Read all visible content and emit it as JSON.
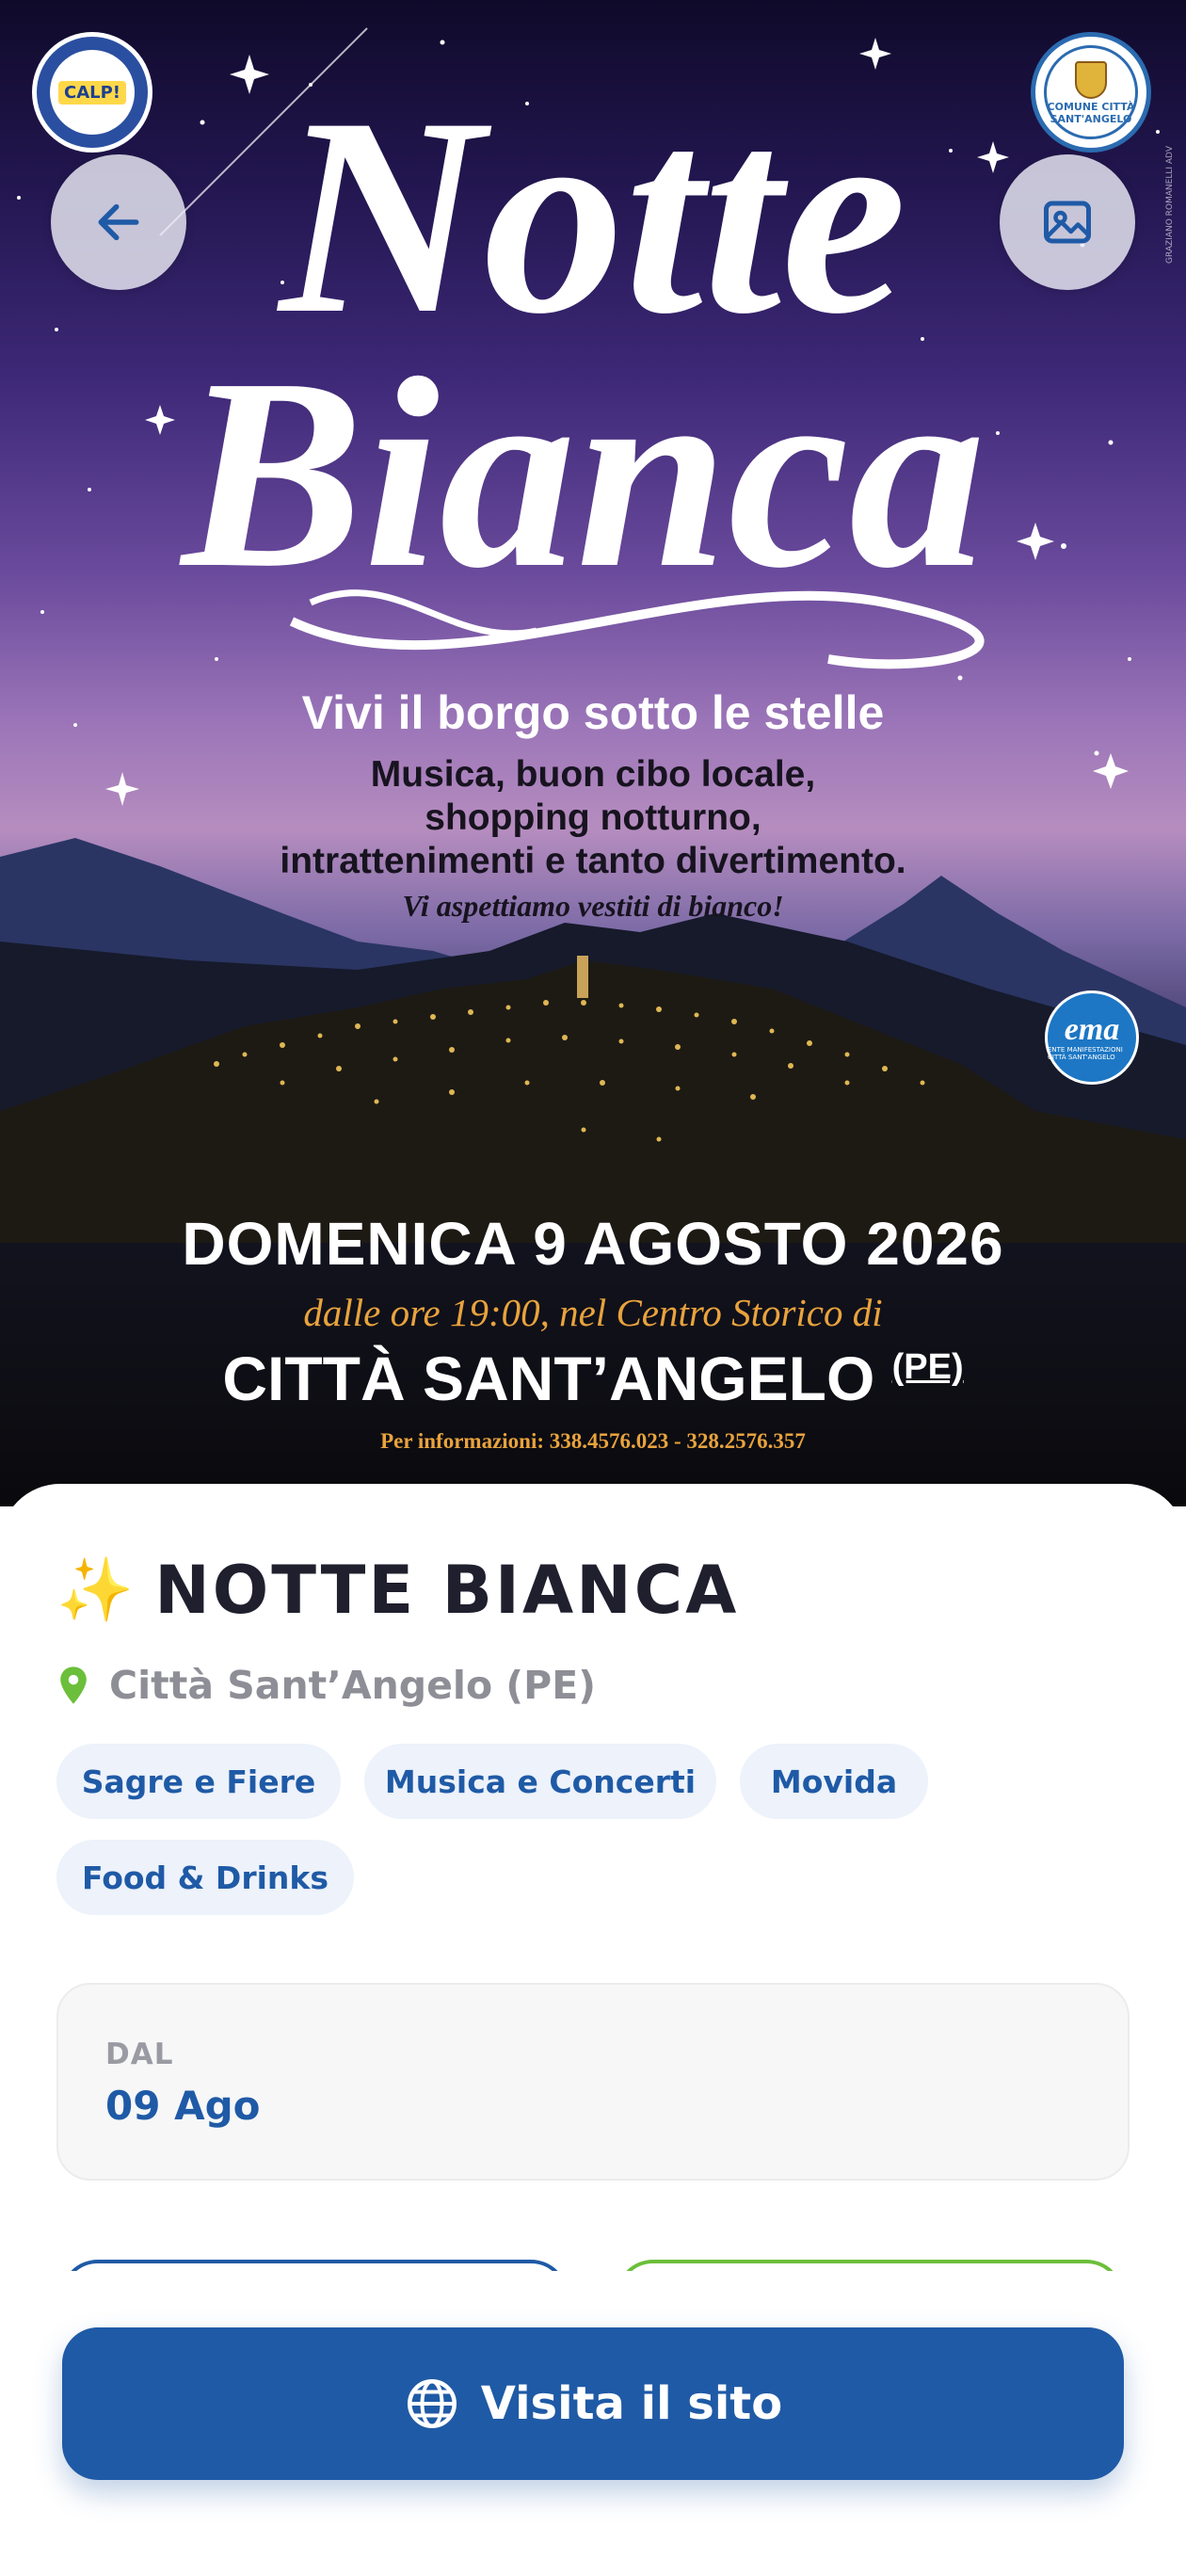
{
  "poster": {
    "title_line1": "Notte",
    "title_line2": "Bianca",
    "tagline": "Vivi il borgo sotto le stelle",
    "description": [
      "Musica, buon cibo locale,",
      "shopping notturno,",
      "intrattenimenti e tanto divertimento."
    ],
    "invite": "Vi aspettiamo vestiti di bianco!",
    "date_line": "DOMENICA 9 AGOSTO 2026",
    "time_line": "dalle ore 19:00, nel Centro Storico di",
    "city": "CITTÀ SANT’ANGELO",
    "city_province": "(PE)",
    "info": "Per informazioni: 338.4576.023 - 328.2576.357",
    "logo_left": "CALP!",
    "logo_right": "COMUNE CITTÀ SANT'ANGELO",
    "ema_badge": "ema",
    "ema_sub": "ENTE MANIFESTAZIONI CITTÀ SANT'ANGELO",
    "credit": "GRAZIANO ROMANELLI ADV"
  },
  "colors": {
    "primary": "#1f5aa6",
    "tag_bg": "#edf2fb",
    "location_pin": "#6bbf3a",
    "poster_gold": "#e9a33d"
  },
  "header": {
    "back_icon": "arrow-left-icon",
    "gallery_icon": "image-icon"
  },
  "event": {
    "icon": "sparkles-icon",
    "title": "NOTTE BIANCA",
    "location": "Città Sant’Angelo (PE)",
    "tags": [
      "Sagre e Fiere",
      "Musica e Concerti",
      "Movida",
      "Food & Drinks"
    ],
    "date_label": "DAL",
    "date_value": "09 Ago"
  },
  "actions": {
    "visit_label": "Visita il sito",
    "visit_icon": "globe-icon"
  }
}
